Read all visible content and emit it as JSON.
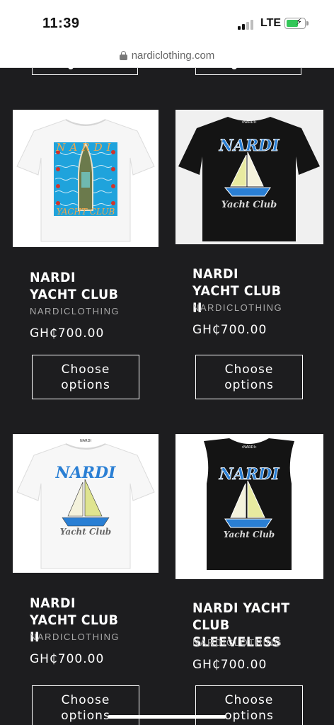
{
  "status_bar": {
    "time": "11:39",
    "network": "LTE"
  },
  "browser": {
    "url": "nardiclothing.com"
  },
  "products": [
    {
      "title": "NARDI YACHT CLUB",
      "vendor": "NARDICLOTHING",
      "price": "GH₵700.00",
      "button": "Choose\noptions",
      "image_alt": "NARDI YACHT CLUB"
    },
    {
      "title": "NARDI YACHT CLUB II",
      "vendor": "NARDICLOTHING",
      "price": "GH₵700.00",
      "button": "Choose\noptions",
      "image_text": {
        "brand": "NARDI",
        "sub": "Yacht Club",
        "tag": "•NARDI•"
      }
    },
    {
      "title": "NARDI YACHT CLUB II",
      "vendor": "NARDICLOTHING",
      "price": "GH₵700.00",
      "button": "Choose\noptions",
      "image_text": {
        "brand": "NARDI",
        "sub": "Yacht Club",
        "tag": "NARDI"
      }
    },
    {
      "title": "NARDI YACHT CLUB SLEEVELESS",
      "vendor": "NARDICLOTHING",
      "price": "GH₵700.00",
      "button": "Choose\noptions",
      "image_text": {
        "brand": "NARDI",
        "sub": "Yacht Club",
        "tag": "•NARDI•"
      }
    }
  ],
  "colors": {
    "background": "#1d1d1f",
    "shirt_blue": "#2a7fd4",
    "sail_yellow": "#e8eaa0",
    "pool_blue": "#1fa3dc"
  }
}
